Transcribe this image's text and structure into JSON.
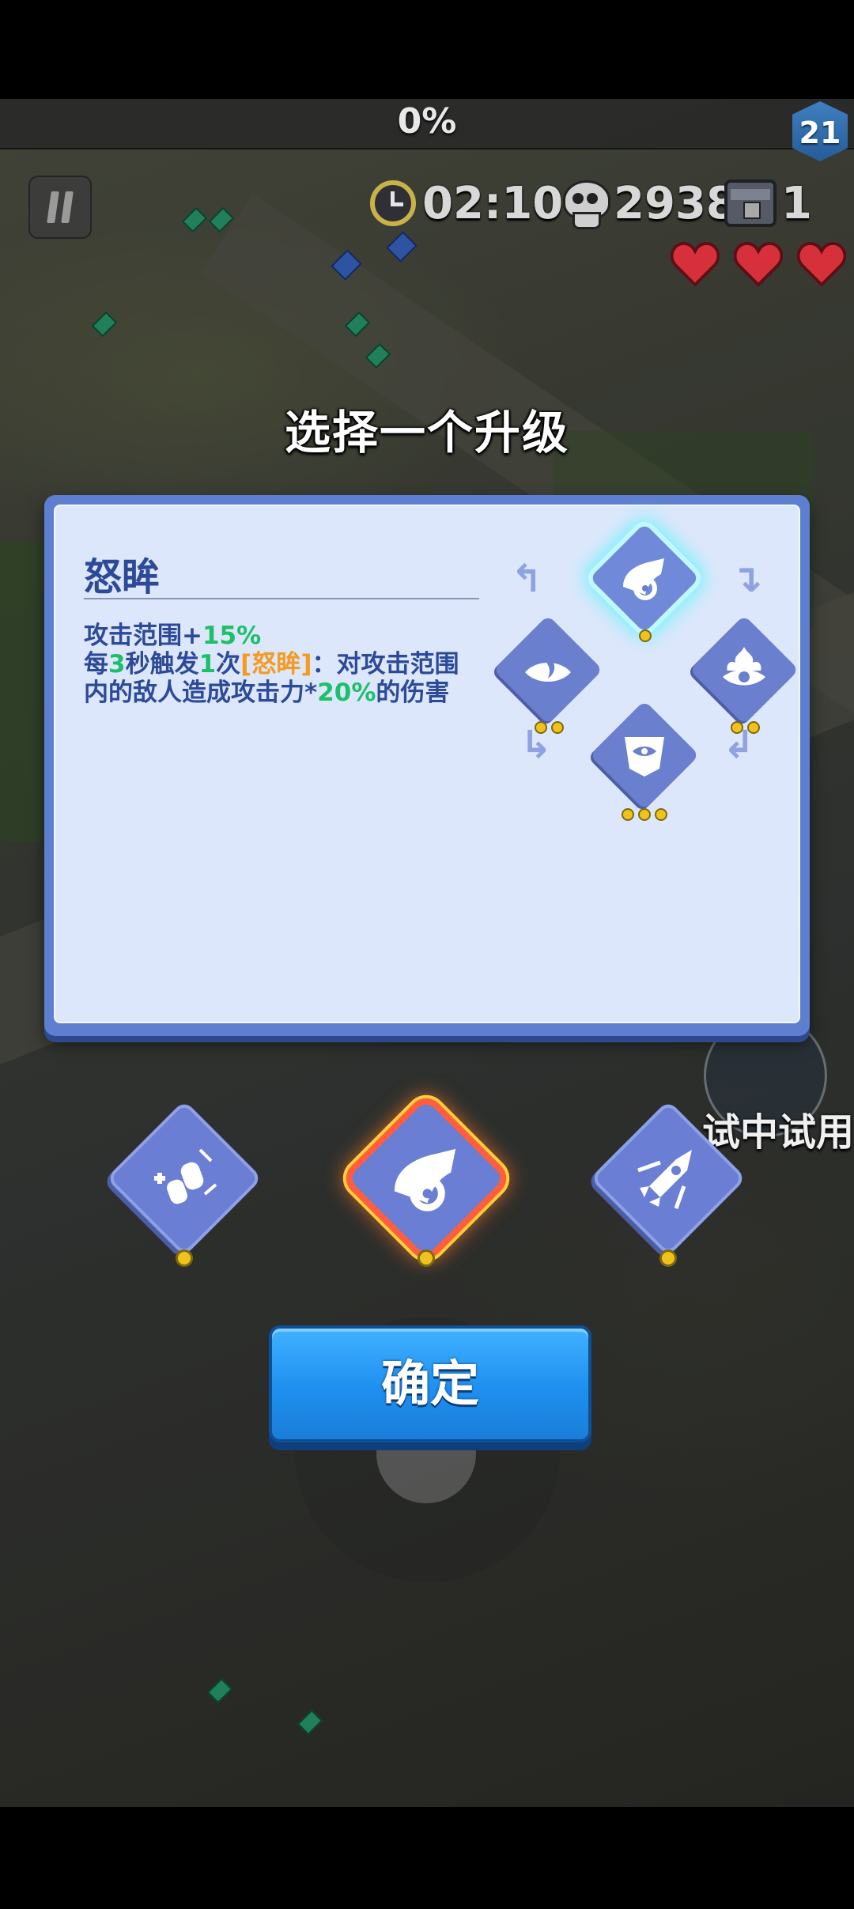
{
  "hud": {
    "progress": "0%",
    "level": "21",
    "timer": "02:10",
    "kills": "2938",
    "chests": "1",
    "hearts": 3,
    "heart_color": "#d6313a"
  },
  "upgrade": {
    "title": "选择一个升级",
    "skill_name": "怒眸",
    "desc_line1_prefix": "攻击范围+",
    "desc_line1_value": "15%",
    "desc_line2_a": "每",
    "desc_line2_num": "3",
    "desc_line2_b": "秒触发",
    "desc_line2_count": "1",
    "desc_line2_c": "次",
    "desc_line2_tag": "[怒眸]",
    "desc_line2_d": "：对攻击范围",
    "desc_line3_a": "内的敌人造成攻击力*",
    "desc_line3_value": "20%",
    "desc_line3_b": "的伤害",
    "tree": [
      {
        "icon": "horn-icon",
        "level_dots": 1,
        "active": true
      },
      {
        "icon": "flame-eye-icon",
        "level_dots": 2,
        "active": false
      },
      {
        "icon": "fire-eye-icon",
        "level_dots": 2,
        "active": false
      },
      {
        "icon": "demon-eye-icon",
        "level_dots": 3,
        "active": false
      }
    ]
  },
  "choices": [
    {
      "icon": "boots-icon",
      "selected": false
    },
    {
      "icon": "horn-icon",
      "selected": true
    },
    {
      "icon": "rocket-icon",
      "selected": false
    }
  ],
  "confirm_label": "确定",
  "trial_label": "试中试用",
  "colors": {
    "accent_blue": "#2c4a98",
    "green_value": "#1fbf6a",
    "orange_tag": "#f39b23",
    "button_blue": "#1f8ff0"
  }
}
